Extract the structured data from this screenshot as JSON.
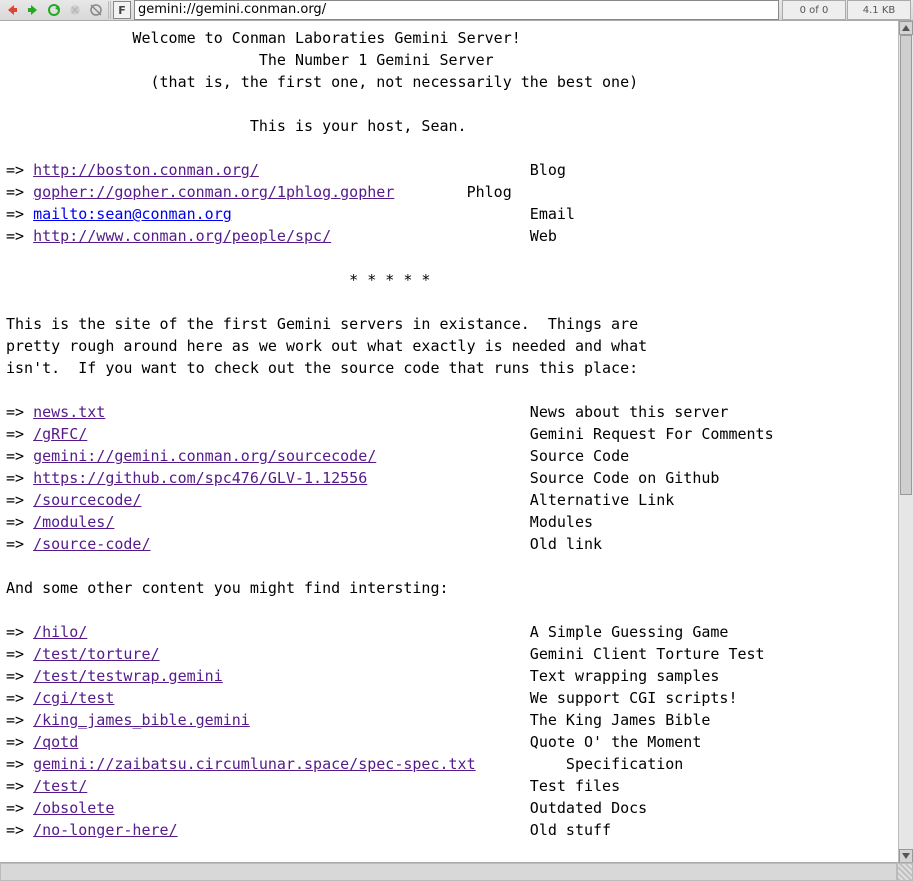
{
  "toolbar": {
    "url": "gemini://gemini.conman.org/",
    "counter": "0 of 0",
    "size": "4.1 KB",
    "ftag": "F"
  },
  "page": {
    "h1": "Welcome to Conman Laboraties Gemini Server!",
    "h2": "The Number 1 Gemini Server",
    "h3": "(that is, the first one, not necessarily the best one)",
    "host": "This is your host, Sean.",
    "divider": "* * * * *",
    "para1": "This is the site of the first Gemini servers in existance.  Things are\npretty rough around here as we work out what exactly is needed and what\nisn't.  If you want to check out the source code that runs this place:",
    "para2": "And some other content you might find intersting:"
  },
  "links_top": [
    {
      "url": "http://boston.conman.org/",
      "label": "Blog",
      "visited": true,
      "col": 58
    },
    {
      "url": "gopher://gopher.conman.org/1phlog.gopher",
      "label": "Phlog",
      "visited": true,
      "col": 51
    },
    {
      "url": "mailto:sean@conman.org",
      "label": "Email",
      "visited": false,
      "col": 58
    },
    {
      "url": "http://www.conman.org/people/spc/",
      "label": "Web",
      "visited": true,
      "col": 58
    }
  ],
  "links_mid": [
    {
      "url": "news.txt",
      "label": "News about this server",
      "visited": true,
      "col": 58
    },
    {
      "url": "/gRFC/",
      "label": "Gemini Request For Comments",
      "visited": true,
      "col": 58
    },
    {
      "url": "gemini://gemini.conman.org/sourcecode/",
      "label": "Source Code",
      "visited": true,
      "col": 58
    },
    {
      "url": "https://github.com/spc476/GLV-1.12556",
      "label": "Source Code on Github",
      "visited": true,
      "col": 58
    },
    {
      "url": "/sourcecode/",
      "label": "Alternative Link",
      "visited": true,
      "col": 58
    },
    {
      "url": "/modules/",
      "label": "Modules",
      "visited": true,
      "col": 58
    },
    {
      "url": "/source-code/",
      "label": "Old link",
      "visited": true,
      "col": 58
    }
  ],
  "links_bot": [
    {
      "url": "/hilo/",
      "label": "A Simple Guessing Game",
      "visited": true,
      "col": 58
    },
    {
      "url": "/test/torture/",
      "label": "Gemini Client Torture Test",
      "visited": true,
      "col": 58
    },
    {
      "url": "/test/testwrap.gemini",
      "label": "Text wrapping samples",
      "visited": true,
      "col": 58
    },
    {
      "url": "/cgi/test",
      "label": "We support CGI scripts!",
      "visited": true,
      "col": 58
    },
    {
      "url": "/king_james_bible.gemini",
      "label": "The King James Bible",
      "visited": true,
      "col": 58
    },
    {
      "url": "/qotd",
      "label": "Quote O' the Moment",
      "visited": true,
      "col": 58
    },
    {
      "url": "gemini://zaibatsu.circumlunar.space/spec-spec.txt",
      "label": "Specification",
      "visited": true,
      "col": 62
    },
    {
      "url": "/test/",
      "label": "Test files",
      "visited": true,
      "col": 58
    },
    {
      "url": "/obsolete",
      "label": "Outdated Docs",
      "visited": true,
      "col": 58
    },
    {
      "url": "/no-longer-here/",
      "label": "Old stuff",
      "visited": true,
      "col": 58
    }
  ]
}
